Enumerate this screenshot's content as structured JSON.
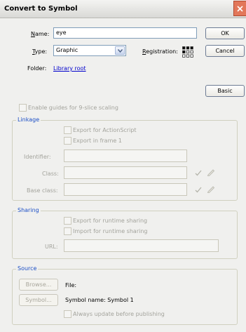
{
  "window": {
    "title": "Convert to Symbol"
  },
  "name": {
    "label": "Name:",
    "value": "eye"
  },
  "type": {
    "label": "Type:",
    "value": "Graphic"
  },
  "registration": {
    "label": "Registration:"
  },
  "folder": {
    "label": "Folder:",
    "link": "Library root"
  },
  "buttons": {
    "ok": "OK",
    "cancel": "Cancel",
    "basic": "Basic"
  },
  "nine_slice": {
    "label": "Enable guides for 9-slice scaling"
  },
  "linkage": {
    "title": "Linkage",
    "export_actionscript": "Export for ActionScript",
    "export_frame1": "Export in frame 1",
    "identifier_label": "Identifier:",
    "class_label": "Class:",
    "base_class_label": "Base class:"
  },
  "sharing": {
    "title": "Sharing",
    "export_runtime": "Export for runtime sharing",
    "import_runtime": "Import for runtime sharing",
    "url_label": "URL:"
  },
  "source": {
    "title": "Source",
    "browse_button": "Browse...",
    "symbol_button": "Symbol...",
    "file_label": "File:",
    "symbol_name": "Symbol name: Symbol 1",
    "always_update": "Always update before publishing"
  },
  "colors": {
    "accent": "#1c4fc6",
    "link": "#0000cc",
    "disabled": "#a3a39c"
  }
}
